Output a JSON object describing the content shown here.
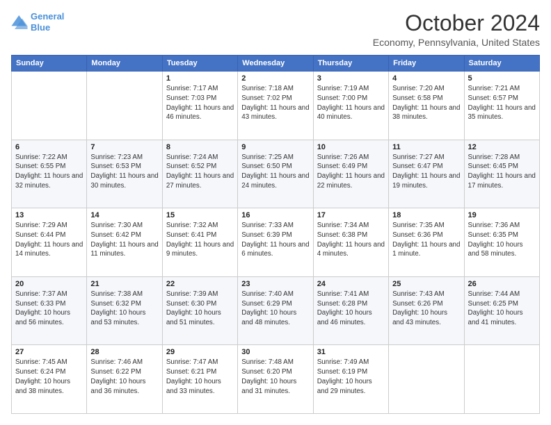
{
  "header": {
    "logo_line1": "General",
    "logo_line2": "Blue",
    "month_title": "October 2024",
    "location": "Economy, Pennsylvania, United States"
  },
  "weekdays": [
    "Sunday",
    "Monday",
    "Tuesday",
    "Wednesday",
    "Thursday",
    "Friday",
    "Saturday"
  ],
  "weeks": [
    [
      {
        "day": "",
        "info": ""
      },
      {
        "day": "",
        "info": ""
      },
      {
        "day": "1",
        "info": "Sunrise: 7:17 AM\nSunset: 7:03 PM\nDaylight: 11 hours and 46 minutes."
      },
      {
        "day": "2",
        "info": "Sunrise: 7:18 AM\nSunset: 7:02 PM\nDaylight: 11 hours and 43 minutes."
      },
      {
        "day": "3",
        "info": "Sunrise: 7:19 AM\nSunset: 7:00 PM\nDaylight: 11 hours and 40 minutes."
      },
      {
        "day": "4",
        "info": "Sunrise: 7:20 AM\nSunset: 6:58 PM\nDaylight: 11 hours and 38 minutes."
      },
      {
        "day": "5",
        "info": "Sunrise: 7:21 AM\nSunset: 6:57 PM\nDaylight: 11 hours and 35 minutes."
      }
    ],
    [
      {
        "day": "6",
        "info": "Sunrise: 7:22 AM\nSunset: 6:55 PM\nDaylight: 11 hours and 32 minutes."
      },
      {
        "day": "7",
        "info": "Sunrise: 7:23 AM\nSunset: 6:53 PM\nDaylight: 11 hours and 30 minutes."
      },
      {
        "day": "8",
        "info": "Sunrise: 7:24 AM\nSunset: 6:52 PM\nDaylight: 11 hours and 27 minutes."
      },
      {
        "day": "9",
        "info": "Sunrise: 7:25 AM\nSunset: 6:50 PM\nDaylight: 11 hours and 24 minutes."
      },
      {
        "day": "10",
        "info": "Sunrise: 7:26 AM\nSunset: 6:49 PM\nDaylight: 11 hours and 22 minutes."
      },
      {
        "day": "11",
        "info": "Sunrise: 7:27 AM\nSunset: 6:47 PM\nDaylight: 11 hours and 19 minutes."
      },
      {
        "day": "12",
        "info": "Sunrise: 7:28 AM\nSunset: 6:45 PM\nDaylight: 11 hours and 17 minutes."
      }
    ],
    [
      {
        "day": "13",
        "info": "Sunrise: 7:29 AM\nSunset: 6:44 PM\nDaylight: 11 hours and 14 minutes."
      },
      {
        "day": "14",
        "info": "Sunrise: 7:30 AM\nSunset: 6:42 PM\nDaylight: 11 hours and 11 minutes."
      },
      {
        "day": "15",
        "info": "Sunrise: 7:32 AM\nSunset: 6:41 PM\nDaylight: 11 hours and 9 minutes."
      },
      {
        "day": "16",
        "info": "Sunrise: 7:33 AM\nSunset: 6:39 PM\nDaylight: 11 hours and 6 minutes."
      },
      {
        "day": "17",
        "info": "Sunrise: 7:34 AM\nSunset: 6:38 PM\nDaylight: 11 hours and 4 minutes."
      },
      {
        "day": "18",
        "info": "Sunrise: 7:35 AM\nSunset: 6:36 PM\nDaylight: 11 hours and 1 minute."
      },
      {
        "day": "19",
        "info": "Sunrise: 7:36 AM\nSunset: 6:35 PM\nDaylight: 10 hours and 58 minutes."
      }
    ],
    [
      {
        "day": "20",
        "info": "Sunrise: 7:37 AM\nSunset: 6:33 PM\nDaylight: 10 hours and 56 minutes."
      },
      {
        "day": "21",
        "info": "Sunrise: 7:38 AM\nSunset: 6:32 PM\nDaylight: 10 hours and 53 minutes."
      },
      {
        "day": "22",
        "info": "Sunrise: 7:39 AM\nSunset: 6:30 PM\nDaylight: 10 hours and 51 minutes."
      },
      {
        "day": "23",
        "info": "Sunrise: 7:40 AM\nSunset: 6:29 PM\nDaylight: 10 hours and 48 minutes."
      },
      {
        "day": "24",
        "info": "Sunrise: 7:41 AM\nSunset: 6:28 PM\nDaylight: 10 hours and 46 minutes."
      },
      {
        "day": "25",
        "info": "Sunrise: 7:43 AM\nSunset: 6:26 PM\nDaylight: 10 hours and 43 minutes."
      },
      {
        "day": "26",
        "info": "Sunrise: 7:44 AM\nSunset: 6:25 PM\nDaylight: 10 hours and 41 minutes."
      }
    ],
    [
      {
        "day": "27",
        "info": "Sunrise: 7:45 AM\nSunset: 6:24 PM\nDaylight: 10 hours and 38 minutes."
      },
      {
        "day": "28",
        "info": "Sunrise: 7:46 AM\nSunset: 6:22 PM\nDaylight: 10 hours and 36 minutes."
      },
      {
        "day": "29",
        "info": "Sunrise: 7:47 AM\nSunset: 6:21 PM\nDaylight: 10 hours and 33 minutes."
      },
      {
        "day": "30",
        "info": "Sunrise: 7:48 AM\nSunset: 6:20 PM\nDaylight: 10 hours and 31 minutes."
      },
      {
        "day": "31",
        "info": "Sunrise: 7:49 AM\nSunset: 6:19 PM\nDaylight: 10 hours and 29 minutes."
      },
      {
        "day": "",
        "info": ""
      },
      {
        "day": "",
        "info": ""
      }
    ]
  ]
}
